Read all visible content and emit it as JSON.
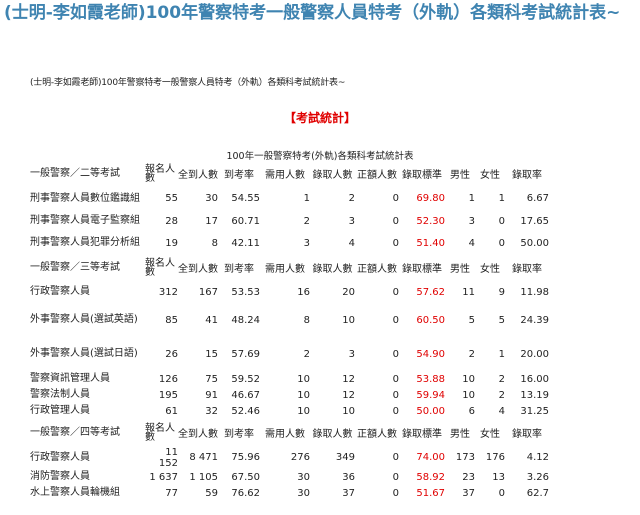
{
  "post_title": "(士明-李如霞老師)100年警察特考一般警察人員特考（外軌）各類科考試統計表~",
  "subtitle": "(士明-李如霞老師)100年警察特考一般警察人員特考（外軌）各類科考試統計表~",
  "section_title": "【考試統計】",
  "table_caption": "100年一般警察特考(外軌)各類科考試統計表",
  "colors": {
    "title_blue": "#3f84b1",
    "red": "#e00000"
  },
  "headers": [
    "報名人數",
    "全到人數",
    "到考率",
    "需用人數",
    "錄取人數",
    "正額人數",
    "錄取標準",
    "男性",
    "女性",
    "錄取率"
  ],
  "groups": [
    {
      "title": "一般警察／二等考試",
      "rows": [
        {
          "name": "刑事警察人員數位鑑識組",
          "values": [
            "55",
            "30",
            "54.55",
            "1",
            "2",
            "0",
            "69.80",
            "1",
            "1",
            "6.67"
          ]
        },
        {
          "name": "刑事警察人員電子監察組",
          "values": [
            "28",
            "17",
            "60.71",
            "2",
            "3",
            "0",
            "52.30",
            "3",
            "0",
            "17.65"
          ]
        },
        {
          "name": "刑事警察人員犯罪分析組",
          "values": [
            "19",
            "8",
            "42.11",
            "3",
            "4",
            "0",
            "51.40",
            "4",
            "0",
            "50.00"
          ]
        }
      ]
    },
    {
      "title": "一般警察／三等考試",
      "rows": [
        {
          "name": "行政警察人員",
          "values": [
            "312",
            "167",
            "53.53",
            "16",
            "20",
            "0",
            "57.62",
            "11",
            "9",
            "11.98"
          ]
        },
        {
          "name": "外事警察人員(選試英語)",
          "values": [
            "85",
            "41",
            "48.24",
            "8",
            "10",
            "0",
            "60.50",
            "5",
            "5",
            "24.39"
          ]
        },
        {
          "name": "外事警察人員(選試日語)",
          "values": [
            "26",
            "15",
            "57.69",
            "2",
            "3",
            "0",
            "54.90",
            "2",
            "1",
            "20.00"
          ]
        },
        {
          "name": "警察資訊管理人員",
          "values": [
            "126",
            "75",
            "59.52",
            "10",
            "12",
            "0",
            "53.88",
            "10",
            "2",
            "16.00"
          ]
        },
        {
          "name": "警察法制人員",
          "values": [
            "195",
            "91",
            "46.67",
            "10",
            "12",
            "0",
            "59.94",
            "10",
            "2",
            "13.19"
          ]
        },
        {
          "name": "行政管理人員",
          "values": [
            "61",
            "32",
            "52.46",
            "10",
            "10",
            "0",
            "50.00",
            "6",
            "4",
            "31.25"
          ]
        }
      ]
    },
    {
      "title": "一般警察／四等考試",
      "rows": [
        {
          "name": "行政警察人員",
          "values": [
            "11 152",
            "8 471",
            "75.96",
            "276",
            "349",
            "0",
            "74.00",
            "173",
            "176",
            "4.12"
          ]
        },
        {
          "name": "消防警察人員",
          "values": [
            "1 637",
            "1 105",
            "67.50",
            "30",
            "36",
            "0",
            "58.92",
            "23",
            "13",
            "3.26"
          ]
        },
        {
          "name": "水上警察人員輪機組",
          "values": [
            "77",
            "59",
            "76.62",
            "30",
            "37",
            "0",
            "51.67",
            "37",
            "0",
            "62.7"
          ]
        }
      ]
    }
  ]
}
